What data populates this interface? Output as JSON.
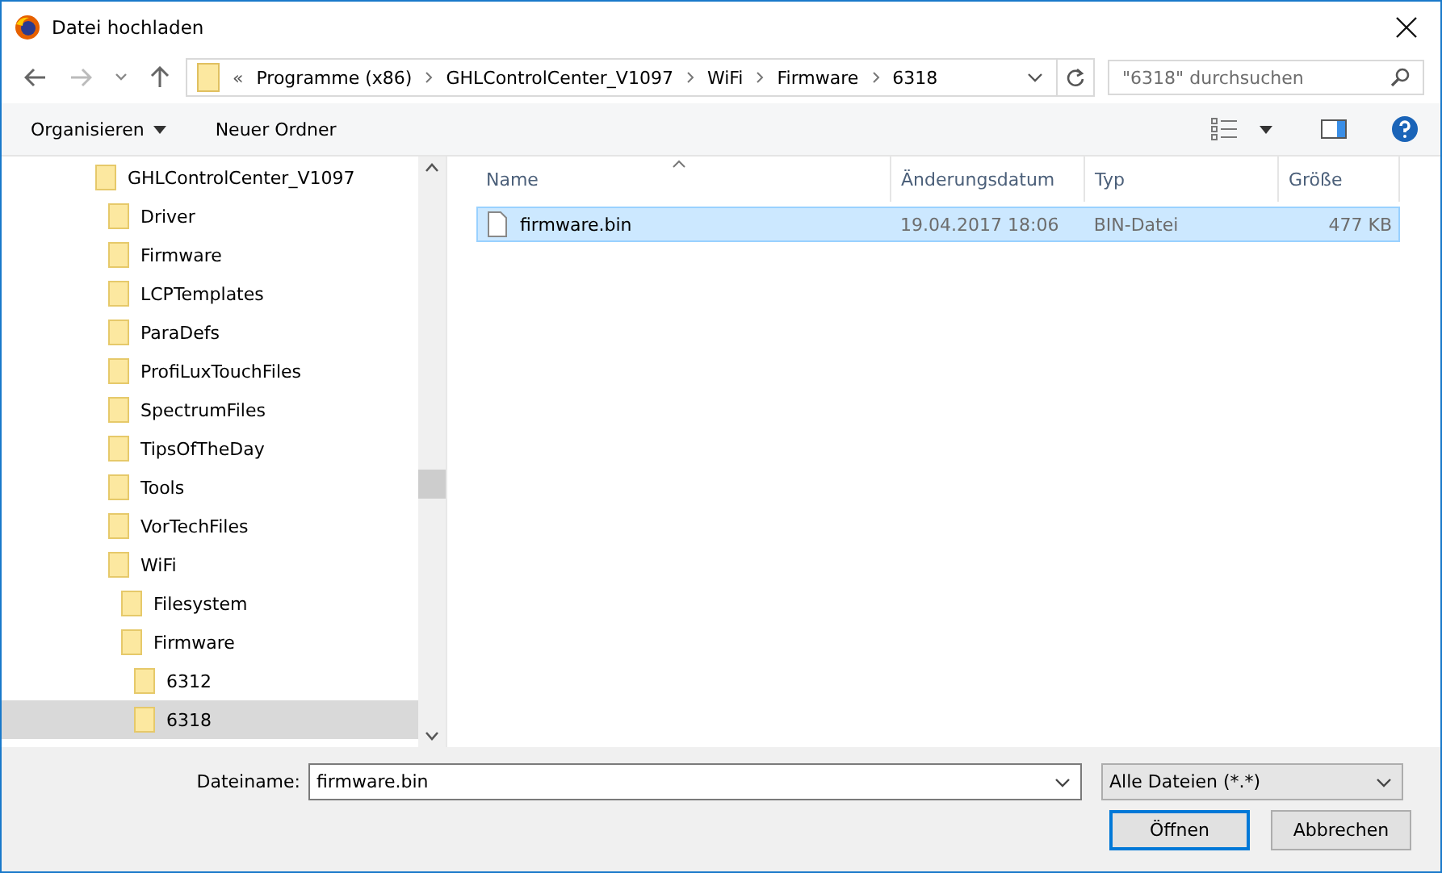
{
  "window": {
    "title": "Datei hochladen"
  },
  "breadcrumb": {
    "overflow": "«",
    "segments": [
      "Programme (x86)",
      "GHLControlCenter_V1097",
      "WiFi",
      "Firmware",
      "6318"
    ]
  },
  "search": {
    "placeholder": "\"6318\" durchsuchen"
  },
  "toolbar": {
    "organize": "Organisieren",
    "new_folder": "Neuer Ordner"
  },
  "tree": [
    {
      "label": "GHLControlCenter_V1097",
      "selected": false,
      "children": [
        {
          "label": "Driver",
          "selected": false
        },
        {
          "label": "Firmware",
          "selected": false
        },
        {
          "label": "LCPTemplates",
          "selected": false
        },
        {
          "label": "ParaDefs",
          "selected": false
        },
        {
          "label": "ProfiLuxTouchFiles",
          "selected": false
        },
        {
          "label": "SpectrumFiles",
          "selected": false
        },
        {
          "label": "TipsOfTheDay",
          "selected": false
        },
        {
          "label": "Tools",
          "selected": false
        },
        {
          "label": "VorTechFiles",
          "selected": false
        },
        {
          "label": "WiFi",
          "selected": false,
          "children": [
            {
              "label": "Filesystem",
              "selected": false
            },
            {
              "label": "Firmware",
              "selected": false,
              "children": [
                {
                  "label": "6312",
                  "selected": false
                },
                {
                  "label": "6318",
                  "selected": true
                }
              ]
            }
          ]
        }
      ]
    }
  ],
  "table": {
    "columns": [
      "Name",
      "Änderungsdatum",
      "Typ",
      "Größe"
    ],
    "rows": [
      {
        "name": "firmware.bin",
        "date": "19.04.2017 18:06",
        "type": "BIN-Datei",
        "size": "477 KB",
        "selected": true
      }
    ]
  },
  "filename": {
    "label": "Dateiname:",
    "value": "firmware.bin"
  },
  "filter": {
    "value": "Alle Dateien (*.*)"
  },
  "buttons": [
    {
      "label": "Öffnen",
      "default": true
    },
    {
      "label": "Abbrechen",
      "default": false
    }
  ]
}
